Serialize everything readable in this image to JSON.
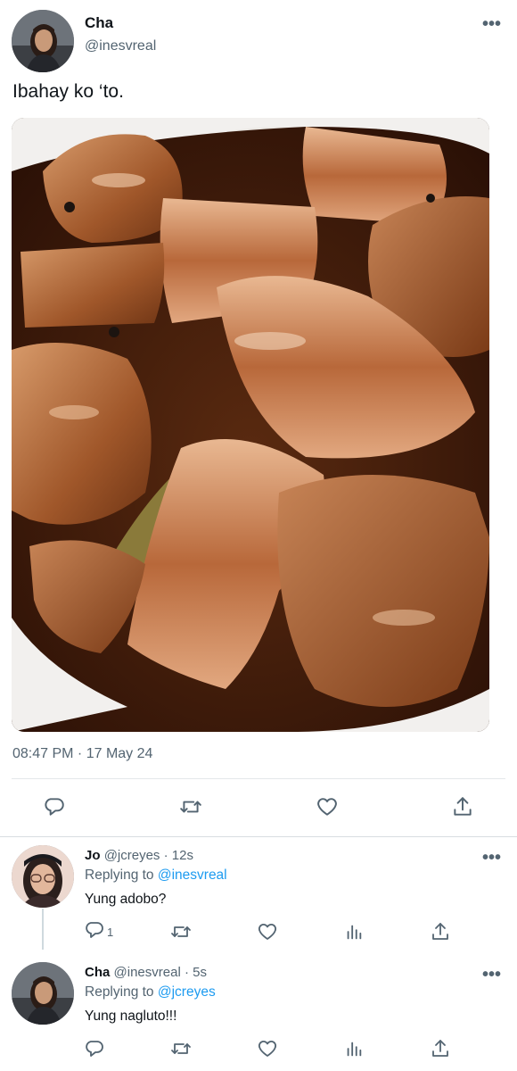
{
  "main_tweet": {
    "name": "Cha",
    "handle": "@inesvreal",
    "text": "Ibahay ko ‘to.",
    "timestamp": "08:47 PM · 17 May 24",
    "more_label": "•••",
    "actions": [
      "reply-icon",
      "retweet-icon",
      "like-icon",
      "share-icon"
    ]
  },
  "replies": [
    {
      "name": "Jo",
      "handle": "@jcreyes",
      "dot": "·",
      "time": "12s",
      "replying_prefix": "Replying to",
      "replying_to": "@inesvreal",
      "text": "Yung adobo?",
      "reply_count": "1",
      "more_label": "•••"
    },
    {
      "name": "Cha",
      "handle": "@inesvreal",
      "dot": "·",
      "time": "5s",
      "replying_prefix": "Replying to",
      "replying_to": "@jcreyes",
      "text": "Yung nagluto!!!",
      "reply_count": "",
      "more_label": "•••"
    }
  ],
  "colors": {
    "text": "#0f1419",
    "secondary": "#536471",
    "link": "#1d9bf0",
    "divider": "#e4e7ea"
  }
}
